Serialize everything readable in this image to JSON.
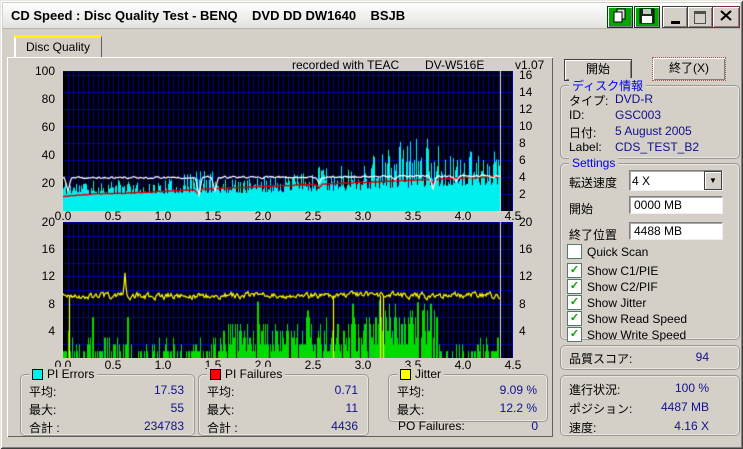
{
  "window": {
    "title": "CD Speed : Disc Quality Test - BENQ    DVD DD DW1640    BSJB"
  },
  "tab": {
    "label": "Disc Quality"
  },
  "chart_header": {
    "recorded_with": "recorded with TEAC",
    "drive": "DV-W516E",
    "version": "v1.07"
  },
  "icons": {
    "dropdown_arrow": "▼",
    "check": "✓"
  },
  "colors": {
    "pi_errors": "#00F0F0",
    "pi_failures": "#00DC00",
    "jitter": "#FFFF00",
    "read_speed": "#FFFFFF",
    "write_speed": "#D80000",
    "value_text": "#101090",
    "caption_blue": "#0000E8",
    "grid": "#0000A0",
    "plot_bg": "#000000",
    "tab_stripe": "#FFF200"
  },
  "chart_data": [
    {
      "name": "pi-errors-speed-chart",
      "type": "area",
      "x_range": [
        0,
        4.5
      ],
      "x_ticks": [
        0.0,
        0.5,
        1.0,
        1.5,
        2.0,
        2.5,
        3.0,
        3.5,
        4.0,
        4.5
      ],
      "x_grid_step": 0.05,
      "left_axis": {
        "max": 100,
        "ticks": [
          100,
          80,
          60,
          40,
          20
        ]
      },
      "right_axis": {
        "max": 16.45,
        "ticks": [
          16,
          14,
          12,
          10,
          8,
          6,
          4,
          2
        ]
      },
      "h_grid_scale": "right",
      "h_grid_values": [
        2,
        4,
        6,
        8,
        10,
        12,
        14,
        16
      ],
      "cursor_x": 4.37,
      "series": [
        {
          "name": "pi-errors",
          "type": "spike-area",
          "color": "#00F0F0",
          "scale": "left",
          "end": 4.37,
          "seed": 11,
          "floor": [
            [
              0,
              12
            ],
            [
              2,
              13
            ],
            [
              2.5,
              14
            ],
            [
              3,
              15
            ],
            [
              3.5,
              17
            ],
            [
              4.37,
              19
            ]
          ],
          "peak": [
            [
              0,
              24
            ],
            [
              0.25,
              21
            ],
            [
              0.5,
              23
            ],
            [
              0.8,
              20
            ],
            [
              1,
              22
            ],
            [
              1.2,
              26
            ],
            [
              1.35,
              31
            ],
            [
              1.5,
              27
            ],
            [
              1.7,
              23
            ],
            [
              2,
              24
            ],
            [
              2.3,
              26
            ],
            [
              2.55,
              31
            ],
            [
              2.7,
              32
            ],
            [
              2.85,
              34
            ],
            [
              3,
              31
            ],
            [
              3.1,
              40
            ],
            [
              3.2,
              44
            ],
            [
              3.35,
              49
            ],
            [
              3.5,
              53
            ],
            [
              3.6,
              50
            ],
            [
              3.7,
              57
            ],
            [
              3.8,
              48
            ],
            [
              3.9,
              38
            ],
            [
              4,
              36
            ],
            [
              4.05,
              45
            ],
            [
              4.15,
              40
            ],
            [
              4.25,
              44
            ],
            [
              4.37,
              42
            ]
          ]
        },
        {
          "name": "write-speed",
          "type": "line",
          "color": "#D80000",
          "scale": "left",
          "end": 4.37,
          "seed": 23,
          "width": 1.4,
          "wiggle": 0.25,
          "points": [
            [
              0,
              10.5
            ],
            [
              0.3,
              12
            ],
            [
              0.7,
              13
            ],
            [
              1,
              14
            ],
            [
              1.5,
              16
            ],
            [
              2,
              17.5
            ],
            [
              2.5,
              19
            ],
            [
              3,
              20.5
            ],
            [
              3.5,
              22
            ],
            [
              4,
              23.5
            ],
            [
              4.37,
              24.5
            ]
          ],
          "dips": [
            [
              1.35,
              3
            ],
            [
              2.56,
              3
            ],
            [
              3.7,
              2.5
            ]
          ]
        },
        {
          "name": "read-speed",
          "type": "line",
          "color": "#FFFFFF",
          "scale": "left",
          "end": 4.37,
          "seed": 37,
          "width": 1.2,
          "wiggle": 0.7,
          "points": [
            [
              0,
              23.5
            ],
            [
              1,
              24
            ],
            [
              2,
              24
            ],
            [
              3,
              24.5
            ],
            [
              4.37,
              25
            ]
          ],
          "dips": [
            [
              0.05,
              9
            ],
            [
              1.36,
              12
            ],
            [
              1.52,
              10
            ],
            [
              2.56,
              4
            ],
            [
              3.32,
              3
            ],
            [
              3.7,
              9
            ],
            [
              3.93,
              4
            ]
          ]
        }
      ]
    },
    {
      "name": "pi-failures-jitter-chart",
      "type": "bars",
      "x_range": [
        0,
        4.5
      ],
      "x_ticks": [
        0.0,
        0.5,
        1.0,
        1.5,
        2.0,
        2.5,
        3.0,
        3.5,
        4.0,
        4.5
      ],
      "x_grid_step": 0.05,
      "left_axis": {
        "max": 20,
        "ticks": [
          20,
          16,
          12,
          8,
          4
        ]
      },
      "right_axis": {
        "max": 20,
        "ticks": [
          20,
          16,
          12,
          8,
          4
        ]
      },
      "h_grid_scale": "left",
      "h_grid_values": [
        2,
        4,
        6,
        8,
        10,
        12,
        14,
        16,
        18,
        20
      ],
      "cursor_x": 4.37,
      "series": [
        {
          "name": "pi-failures",
          "type": "bars",
          "color": "#00DC00",
          "scale": "left",
          "end": 4.37,
          "seed": 51,
          "regions": [
            {
              "from": 0,
              "to": 0.08,
              "max": 4,
              "density": 0.8
            },
            {
              "from": 0.08,
              "to": 1.56,
              "max": 3,
              "density": 0.5
            },
            {
              "from": 1.56,
              "to": 2.3,
              "max": 5,
              "density": 0.88
            },
            {
              "from": 2.3,
              "to": 3.05,
              "max": 6,
              "density": 0.9
            },
            {
              "from": 3.05,
              "to": 3.75,
              "max": 8,
              "density": 0.93
            },
            {
              "from": 3.75,
              "to": 4.1,
              "max": 2,
              "density": 0.45
            },
            {
              "from": 4.1,
              "to": 4.37,
              "max": 3,
              "density": 0.65
            }
          ],
          "spikes": [
            [
              0.3,
              6
            ],
            [
              0.65,
              6
            ],
            [
              1.95,
              8.3
            ],
            [
              2.45,
              7
            ],
            [
              2.9,
              8
            ],
            [
              3.17,
              8.5
            ],
            [
              3.55,
              8.2
            ]
          ]
        },
        {
          "name": "jitter",
          "type": "line",
          "color": "#FFFF00",
          "scale": "left",
          "end": 4.37,
          "seed": 67,
          "width": 1.2,
          "wiggle": 0.45,
          "points": [
            [
              0,
              9.1
            ],
            [
              2,
              9.2
            ],
            [
              4.37,
              9.2
            ]
          ],
          "spikes_up": [
            [
              0.62,
              3.2
            ]
          ],
          "drops": [
            0.06,
            2.7,
            3.17,
            3.2
          ]
        }
      ]
    }
  ],
  "stats": {
    "pi_errors": {
      "title": "PI Errors",
      "rows": [
        {
          "label": "平均:",
          "value": "17.53"
        },
        {
          "label": "最大:",
          "value": "55"
        },
        {
          "label": "合計 :",
          "value": "234783"
        }
      ]
    },
    "pi_failures": {
      "title": "PI Failures",
      "rows": [
        {
          "label": "平均:",
          "value": "0.71"
        },
        {
          "label": "最大:",
          "value": "11"
        },
        {
          "label": "合計 :",
          "value": "4436"
        }
      ]
    },
    "jitter": {
      "title": "Jitter",
      "rows": [
        {
          "label": "平均:",
          "value": "9.09 %"
        },
        {
          "label": "最大:",
          "value": "12.2 %"
        }
      ]
    },
    "po_failures": {
      "label": "PO Failures:",
      "value": "0"
    }
  },
  "panel": {
    "start_button": "開始",
    "exit_button": "終了(X)",
    "disc_info": {
      "title": "ディスク情報",
      "rows": [
        {
          "label": "タイプ:",
          "value": "DVD-R"
        },
        {
          "label": "ID:",
          "value": "GSC003"
        },
        {
          "label": "日付:",
          "value": "5 August 2005"
        },
        {
          "label": "Label:",
          "value": "CDS_TEST_B2"
        }
      ]
    },
    "settings": {
      "title": "Settings",
      "transfer_rate_label": "転送速度",
      "transfer_rate_value": "4 X",
      "start_label": "開始",
      "start_value": "0000 MB",
      "end_label": "終了位置",
      "end_value": "4488 MB",
      "checkboxes": [
        {
          "label": "Quick Scan",
          "checked": false
        },
        {
          "label": "Show C1/PIE",
          "checked": true
        },
        {
          "label": "Show C2/PIF",
          "checked": true
        },
        {
          "label": "Show Jitter",
          "checked": true
        },
        {
          "label": "Show Read Speed",
          "checked": true
        },
        {
          "label": "Show Write Speed",
          "checked": true
        }
      ]
    },
    "quality_score": {
      "label": "品質スコア:",
      "value": "94"
    },
    "progress": {
      "rows": [
        {
          "label": "進行状況:",
          "value": "100 %"
        },
        {
          "label": "ポジション:",
          "value": "4487 MB"
        },
        {
          "label": "速度:",
          "value": "4.16 X"
        }
      ]
    }
  }
}
